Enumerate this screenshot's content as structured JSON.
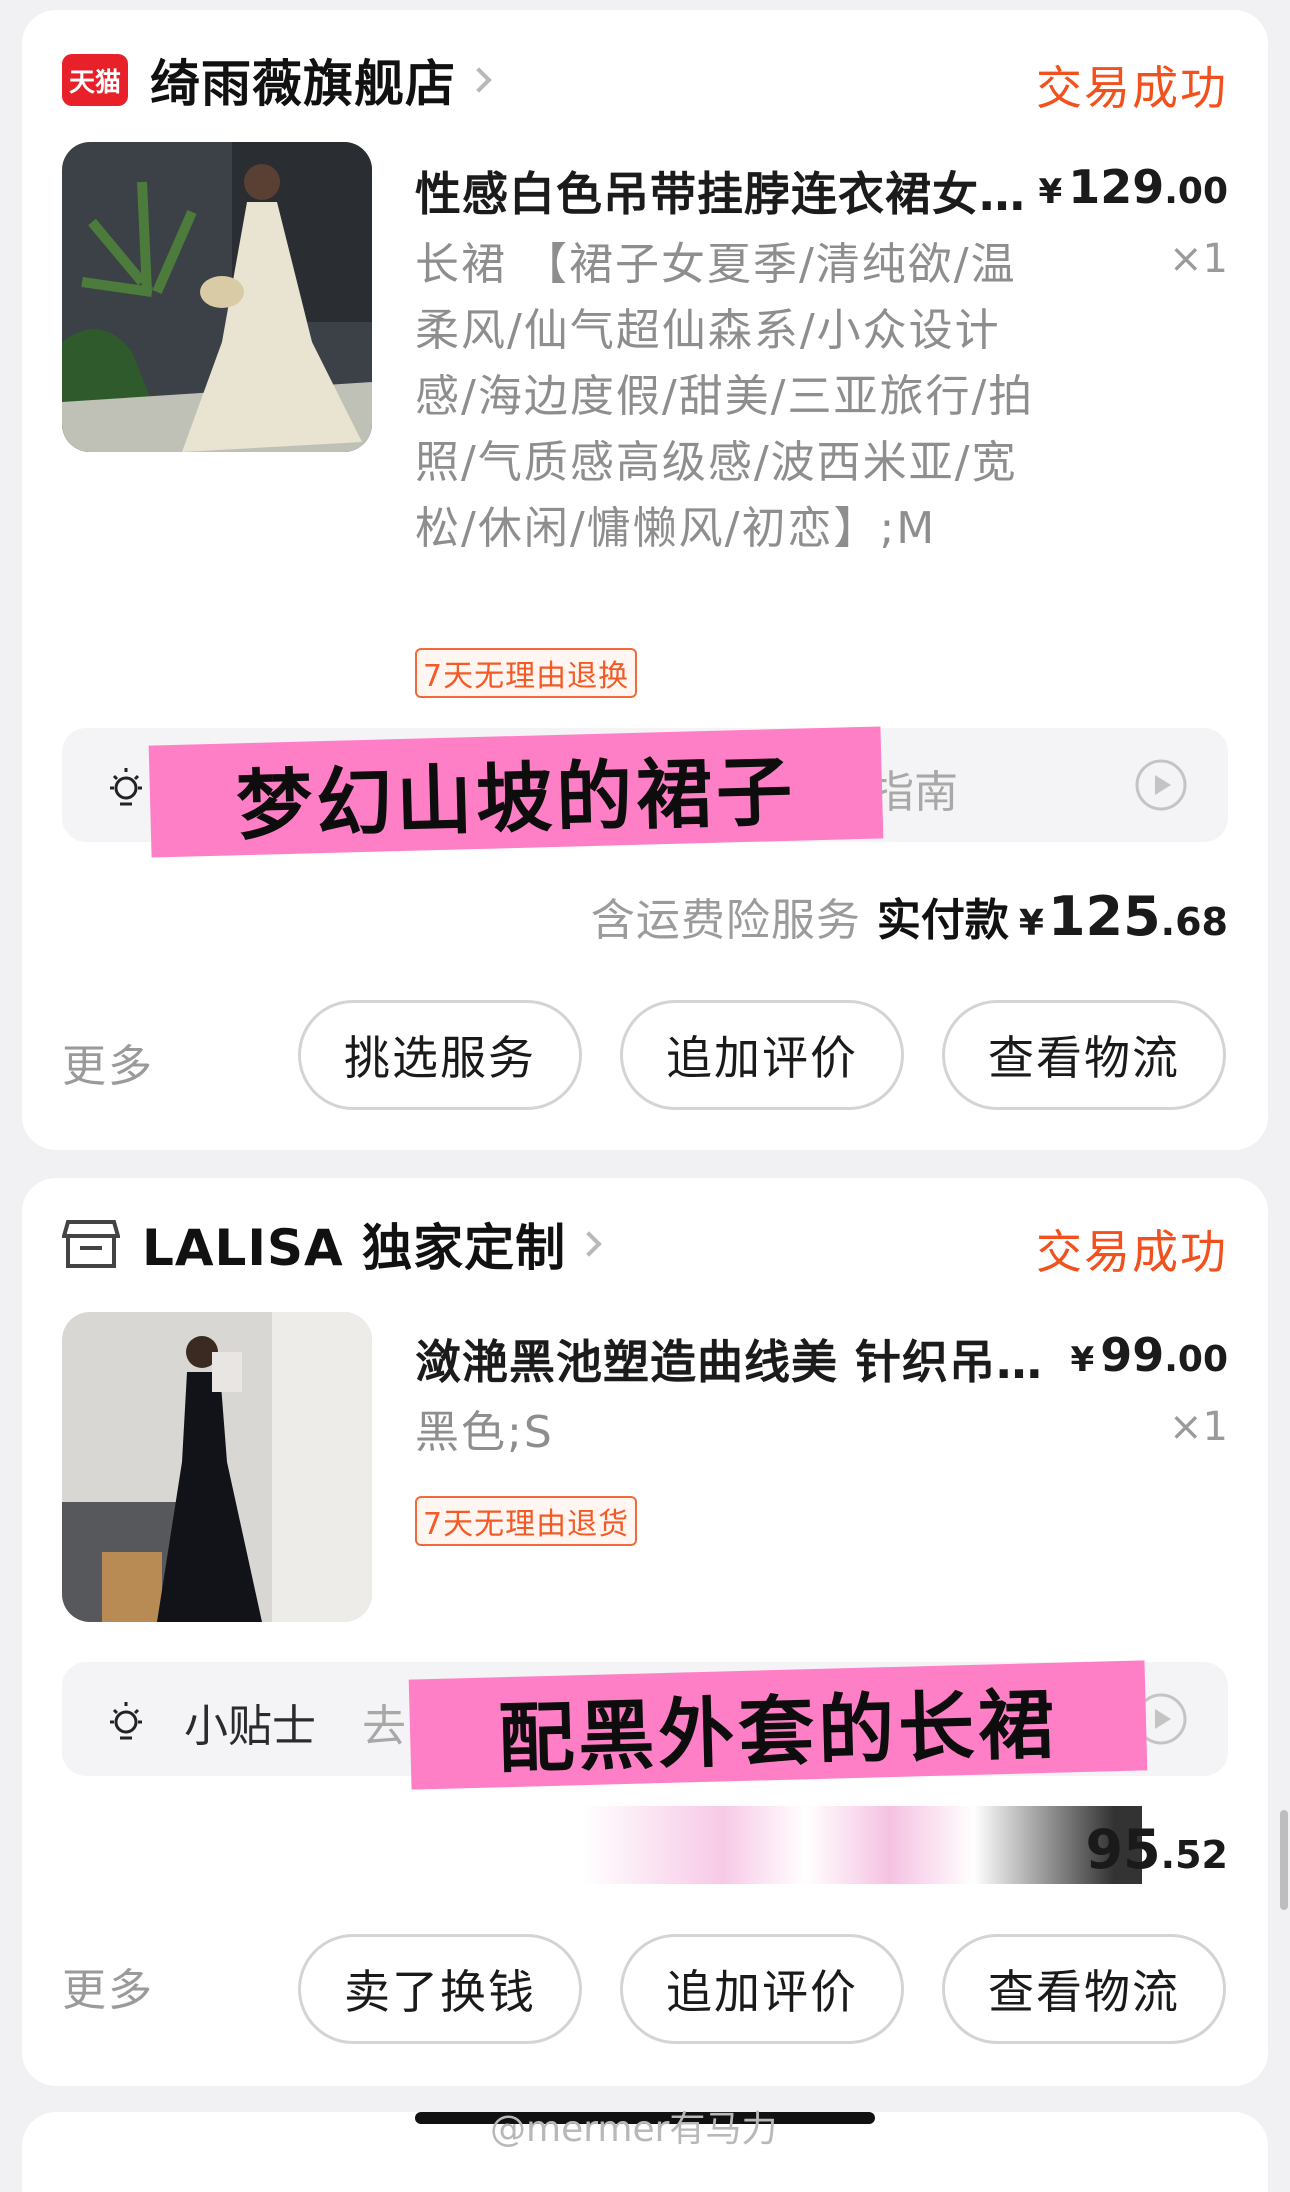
{
  "orders": [
    {
      "shop": {
        "name": "绮雨薇旗舰店",
        "badge": "天猫"
      },
      "status": "交易成功",
      "product": {
        "title": "性感白色吊带挂脖连衣裙女…",
        "price": {
          "symbol": "¥",
          "int": "129",
          "dec": ".00"
        },
        "spec": "长裙 【裙子女夏季/清纯欲/温柔风/仙气超仙森系/小众设计感/海边度假/甜美/三亚旅行/拍照/气质感高级感/波西米亚/宽松/休闲/慵懒风/初恋】;M",
        "qty": "×1",
        "tag": "7天无理由退换"
      },
      "tip": {
        "visible_text": "指南"
      },
      "sticker": "梦幻山坡的裙子",
      "total": {
        "service": "含运费险服务",
        "label": "实付款",
        "symbol": "¥",
        "int": "125",
        "dec": ".68"
      },
      "more": "更多",
      "buttons": [
        "挑选服务",
        "追加评价",
        "查看物流"
      ]
    },
    {
      "shop": {
        "name": "LALISA 独家定制"
      },
      "status": "交易成功",
      "product": {
        "title": "潋滟黑池塑造曲线美 针织吊…",
        "price": {
          "symbol": "¥",
          "int": "99",
          "dec": ".00"
        },
        "spec": "黑色;S",
        "qty": "×1",
        "tag": "7天无理由退货"
      },
      "tip": {
        "label": "小贴士",
        "visible_text": "去"
      },
      "sticker": "配黑外套的长裙",
      "total": {
        "int": "95",
        "dec": ".52"
      },
      "more": "更多",
      "buttons": [
        "卖了换钱",
        "追加评价",
        "查看物流"
      ]
    }
  ],
  "watermark": "@mermer有马力",
  "colors": {
    "accent": "#f2501d",
    "sticker": "#ff7fc6",
    "tmall": "#e8202a"
  }
}
